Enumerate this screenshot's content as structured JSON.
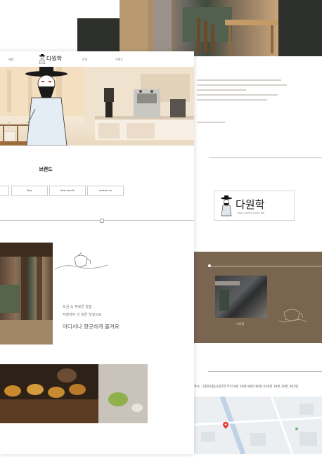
{
  "logo": {
    "text": "다원학",
    "subtitle": "High Quality Asian Tea"
  },
  "nav": {
    "items": [
      "제품",
      "문의",
      "브랜드"
    ]
  },
  "brand_section": {
    "title": "브랜드",
    "buttons": [
      "",
      "Sign",
      "New month",
      "contact us"
    ]
  },
  "story": {
    "line1": "도심 속 푸르른 찻집",
    "line2": "자발에서 갓 따온 찻잎으로",
    "line3": "어디서나 향긋하게 즐겨요"
  },
  "back": {
    "text_intro": "다",
    "brown_caption": "가방형",
    "address": "주소 : 대전(대동)대전역 부지   9번 30번 89번 60번 610번 19번 20번 301번 "
  },
  "colors": {
    "brand_brown": "#7a6550",
    "dark_panel": "#2d302b",
    "hero_cream": "#f1e4d0"
  }
}
